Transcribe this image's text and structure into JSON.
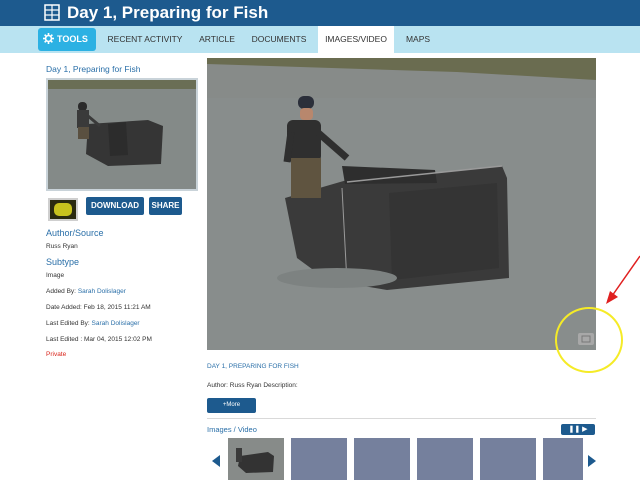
{
  "header": {
    "title": "Day 1, Preparing for Fish",
    "icon": "grid-book-icon",
    "bg_color": "#1d5a8e"
  },
  "tabs": {
    "tools_label": "TOOLS",
    "items": [
      "RECENT ACTIVITY",
      "ARTICLE",
      "DOCUMENTS",
      "IMAGES/VIDEO",
      "MAPS"
    ],
    "active": "IMAGES/VIDEO",
    "bar_color": "#b9e3f1",
    "tools_color": "#2cb1e3"
  },
  "sidebar": {
    "item_title": "Day 1, Preparing for Fish",
    "download_label": "DOWNLOAD",
    "share_label": "SHARE",
    "author_heading": "Author/Source",
    "author_value": "Russ Ryan",
    "subtype_heading": "Subtype",
    "subtype_value": "Image",
    "added_by_label": "Added By:",
    "added_by_value": "Sarah Dolislager",
    "date_added_label": "Date Added:",
    "date_added_value": "Feb 18, 2015 11:21 AM",
    "last_edited_by_label": "Last Edited By:",
    "last_edited_by_value": "Sarah Dolislager",
    "last_edited_label": "Last Edited :",
    "last_edited_value": "Mar 04, 2015 12:02 PM",
    "visibility": "Private"
  },
  "main": {
    "caption_title": "DAY 1, PREPARING FOR FISH",
    "caption_desc": "Author: Russ Ryan Description:",
    "more_label": "+More",
    "gallery_label": "Images / Video",
    "play_label": "❚❚ ▶",
    "gallery_tile_color": "#75809d"
  },
  "annotation": {
    "ring_color": "#f5eb27",
    "arrow_color": "#e02020"
  }
}
